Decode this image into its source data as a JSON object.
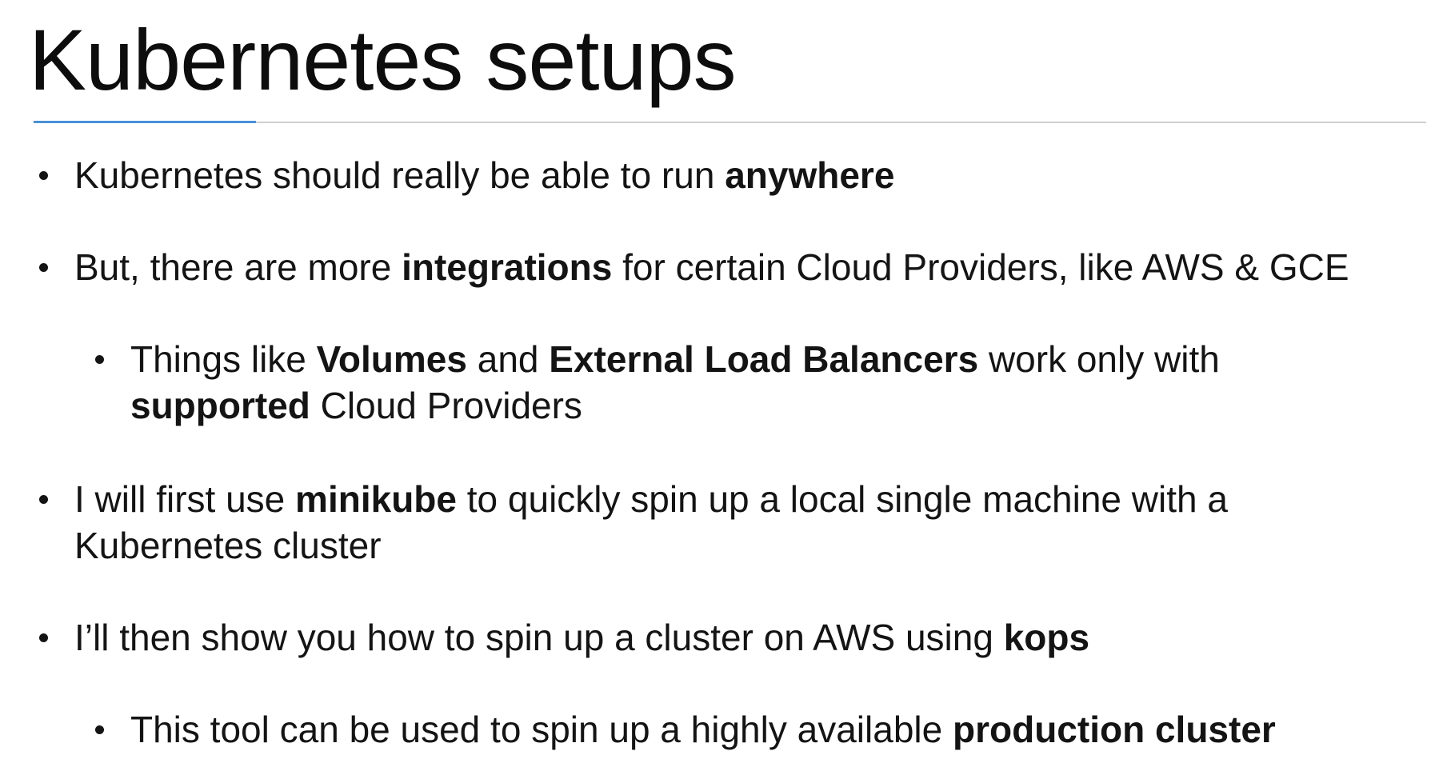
{
  "title": "Kubernetes setups",
  "bullets": [
    {
      "level": 1,
      "lines": [
        [
          {
            "text": "Kubernetes should really be able to run ",
            "bold": false
          },
          {
            "text": "anywhere",
            "bold": true
          }
        ]
      ]
    },
    {
      "level": 1,
      "lines": [
        [
          {
            "text": "But, there are more ",
            "bold": false
          },
          {
            "text": "integrations",
            "bold": true
          },
          {
            "text": " for certain Cloud Providers, like AWS & GCE",
            "bold": false
          }
        ]
      ]
    },
    {
      "level": 2,
      "lines": [
        [
          {
            "text": "Things like ",
            "bold": false
          },
          {
            "text": "Volumes",
            "bold": true
          },
          {
            "text": " and ",
            "bold": false
          },
          {
            "text": "External Load Balancers",
            "bold": true
          },
          {
            "text": " work only with",
            "bold": false
          }
        ],
        [
          {
            "text": "supported",
            "bold": true
          },
          {
            "text": " Cloud Providers",
            "bold": false
          }
        ]
      ]
    },
    {
      "level": 1,
      "lines": [
        [
          {
            "text": "I will first use ",
            "bold": false
          },
          {
            "text": "minikube",
            "bold": true
          },
          {
            "text": " to quickly spin up a local single machine with a",
            "bold": false
          }
        ],
        [
          {
            "text": "Kubernetes cluster",
            "bold": false
          }
        ]
      ]
    },
    {
      "level": 1,
      "lines": [
        [
          {
            "text": "I’ll then show you how to spin up a cluster on AWS using ",
            "bold": false
          },
          {
            "text": "kops",
            "bold": true
          }
        ]
      ]
    },
    {
      "level": 2,
      "lines": [
        [
          {
            "text": "This tool can be used to spin up a highly available ",
            "bold": false
          },
          {
            "text": "production cluster",
            "bold": true
          }
        ]
      ]
    }
  ]
}
